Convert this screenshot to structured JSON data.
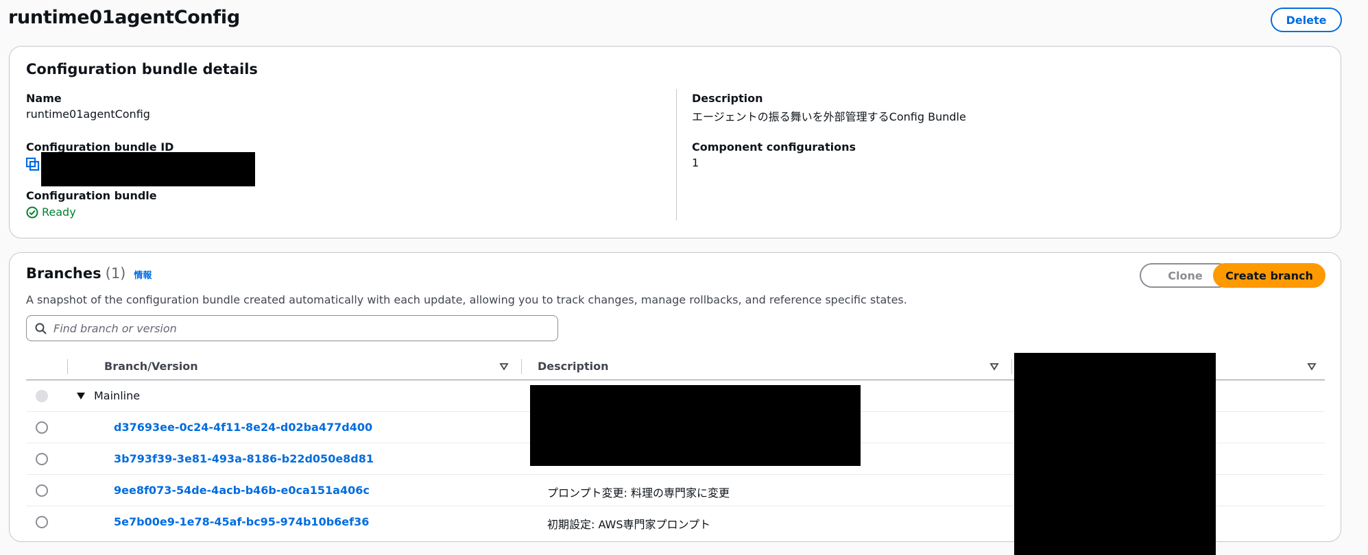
{
  "page": {
    "title": "runtime01agentConfig",
    "delete_label": "Delete"
  },
  "details": {
    "heading": "Configuration bundle details",
    "name_label": "Name",
    "name_value": "runtime01agentConfig",
    "id_label": "Configuration bundle ID",
    "status_label": "Configuration bundle",
    "status_value": "Ready",
    "status_color": "#00802f",
    "description_label": "Description",
    "description_value": "エージェントの振る舞いを外部管理するConfig Bundle",
    "components_label": "Component configurations",
    "components_value": "1"
  },
  "branches": {
    "title": "Branches",
    "count": "(1)",
    "info_link": "情報",
    "description": "A snapshot of the configuration bundle created automatically with each update, allowing you to track changes, manage rollbacks, and reference specific states.",
    "clone_label": "Clone",
    "create_label": "Create branch",
    "search_placeholder": "Find branch or version",
    "columns": [
      "Branch/Version",
      "Description"
    ],
    "mainline_label": "Mainline",
    "versions": [
      {
        "id": "d37693ee-0c24-4f11-8e24-d02ba477d400",
        "description": ""
      },
      {
        "id": "3b793f39-3e81-493a-8186-b22d050e8d81",
        "description": ""
      },
      {
        "id": "9ee8f073-54de-4acb-b46b-e0ca151a406c",
        "description": "プロンプト変更: 料理の専門家に変更"
      },
      {
        "id": "5e7b00e9-1e78-45af-bc95-974b10b6ef36",
        "description": "初期設定: AWS専門家プロンプト"
      }
    ]
  },
  "colors": {
    "link": "#006ce0",
    "primary_button": "#ff9900",
    "success": "#00802f"
  }
}
